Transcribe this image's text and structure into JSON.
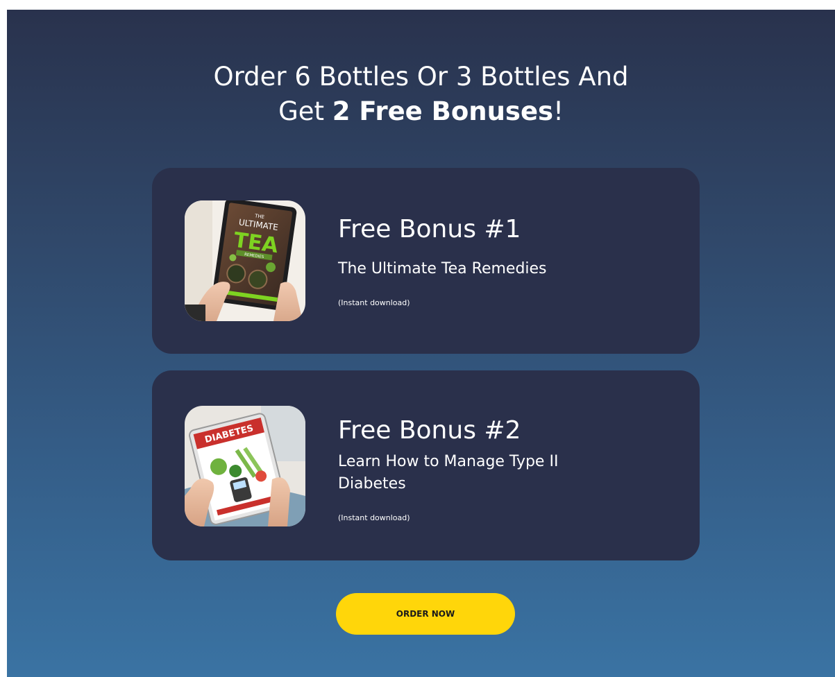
{
  "headline": {
    "line1": "Order 6 Bottles Or 3 Bottles And",
    "line2_prefix": "Get ",
    "line2_strong": "2 Free Bonuses",
    "line2_suffix": "!"
  },
  "bonuses": [
    {
      "title": "Free Bonus #1",
      "description": "The Ultimate Tea Remedies",
      "note": "(Instant download)",
      "image_icon": "tea-ebook-tablet-image",
      "cover_text": {
        "top": "THE",
        "middle": "ULTIMATE",
        "big": "TEA",
        "sub": "REMEDIES"
      }
    },
    {
      "title": "Free Bonus #2",
      "description": "Learn How to Manage Type II Diabetes",
      "note": "(Instant download)",
      "image_icon": "diabetes-ebook-tablet-image",
      "cover_text": {
        "big": "DIABETES"
      }
    }
  ],
  "cta": {
    "label": "ORDER NOW"
  },
  "colors": {
    "gradient_top": "#29324d",
    "gradient_bottom": "#3a73a3",
    "card_bg": "#2a304b",
    "cta_bg": "#ffd60a",
    "text": "#ffffff"
  }
}
